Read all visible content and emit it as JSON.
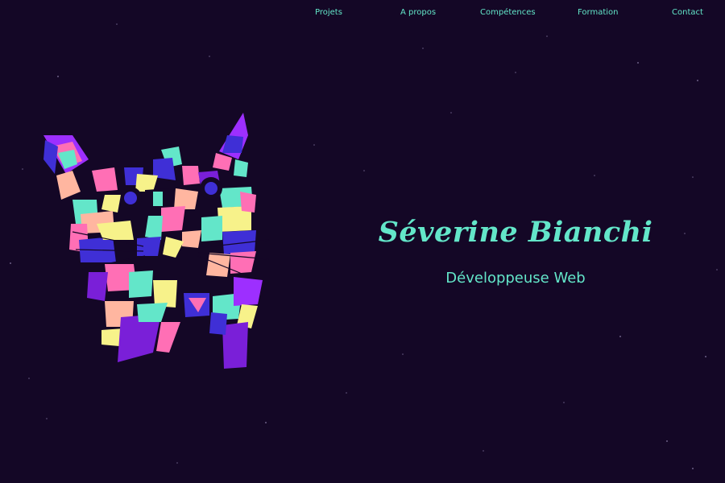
{
  "nav": {
    "items": [
      {
        "label": "Projets"
      },
      {
        "label": "A propos"
      },
      {
        "label": "Compétences"
      },
      {
        "label": "Formation"
      },
      {
        "label": "Contact"
      }
    ]
  },
  "hero": {
    "name": "Séverine Bianchi",
    "role": "Développeuse Web"
  },
  "colors": {
    "background": "#140726",
    "accent": "#63e6c9",
    "art_palette": [
      "#63e6c9",
      "#3f2fd6",
      "#7a1fd8",
      "#ff6fb5",
      "#f7f28a",
      "#ffb6a0",
      "#2a1aa8",
      "#9d2fff"
    ]
  }
}
